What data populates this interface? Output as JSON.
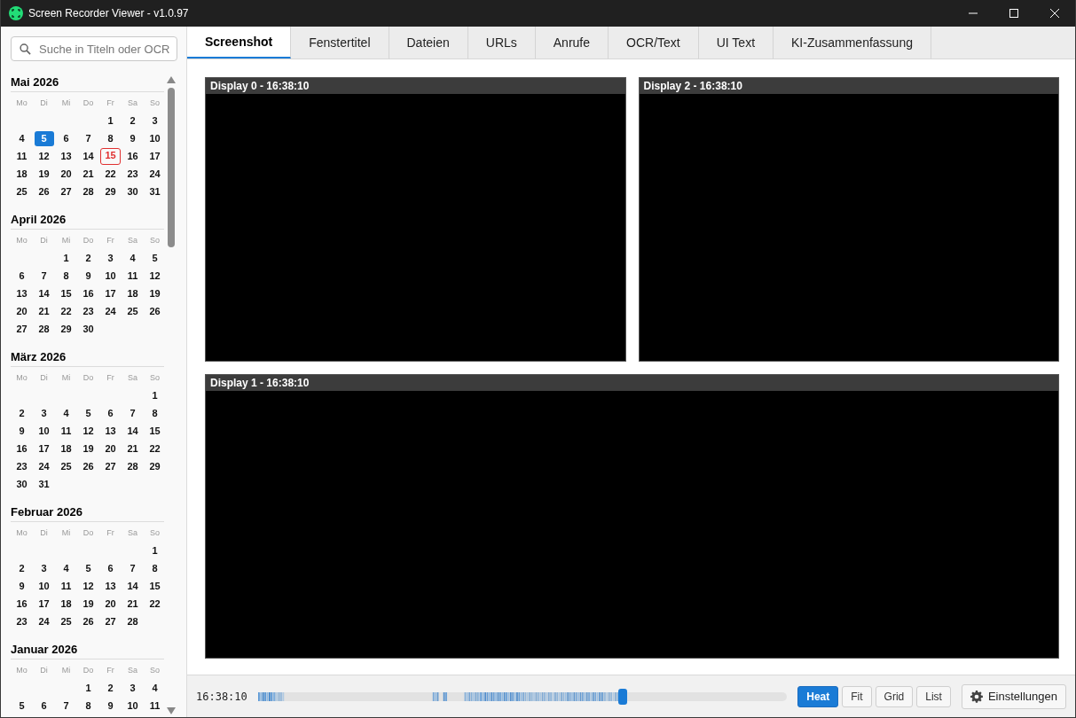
{
  "window": {
    "title": "Screen Recorder Viewer - v1.0.97"
  },
  "search": {
    "placeholder": "Suche in Titeln oder OCR"
  },
  "months": [
    {
      "title": "Mai 2026",
      "weekdays": [
        "Mo",
        "Di",
        "Mi",
        "Do",
        "Fr",
        "Sa",
        "So"
      ],
      "weeks": [
        {
          "kind": "leading",
          "days": [
            {
              "day": "1",
              "selected": false,
              "today": false
            },
            {
              "day": "2",
              "selected": false,
              "today": false
            },
            {
              "day": "3",
              "selected": false,
              "today": false
            }
          ]
        },
        {
          "days": [
            {
              "day": "4",
              "selected": false,
              "today": false
            },
            {
              "day": "5",
              "selected": true,
              "today": false
            },
            {
              "day": "6",
              "selected": false,
              "today": false
            },
            {
              "day": "7",
              "selected": false,
              "today": false
            },
            {
              "day": "8",
              "selected": false,
              "today": false
            },
            {
              "day": "9",
              "selected": false,
              "today": false
            },
            {
              "day": "10",
              "selected": false,
              "today": false
            }
          ]
        },
        {
          "days": [
            {
              "day": "11",
              "selected": false,
              "today": false
            },
            {
              "day": "12",
              "selected": false,
              "today": false
            },
            {
              "day": "13",
              "selected": false,
              "today": false
            },
            {
              "day": "14",
              "selected": false,
              "today": false
            },
            {
              "day": "15",
              "selected": false,
              "today": true
            },
            {
              "day": "16",
              "selected": false,
              "today": false
            },
            {
              "day": "17",
              "selected": false,
              "today": false
            }
          ]
        },
        {
          "days": [
            {
              "day": "18",
              "selected": false,
              "today": false
            },
            {
              "day": "19",
              "selected": false,
              "today": false
            },
            {
              "day": "20",
              "selected": false,
              "today": false
            },
            {
              "day": "21",
              "selected": false,
              "today": false
            },
            {
              "day": "22",
              "selected": false,
              "today": false
            },
            {
              "day": "23",
              "selected": false,
              "today": false
            },
            {
              "day": "24",
              "selected": false,
              "today": false
            }
          ]
        },
        {
          "days": [
            {
              "day": "25",
              "selected": false,
              "today": false
            },
            {
              "day": "26",
              "selected": false,
              "today": false
            },
            {
              "day": "27",
              "selected": false,
              "today": false
            },
            {
              "day": "28",
              "selected": false,
              "today": false
            },
            {
              "day": "29",
              "selected": false,
              "today": false
            },
            {
              "day": "30",
              "selected": false,
              "today": false
            },
            {
              "day": "31",
              "selected": false,
              "today": false
            }
          ]
        }
      ]
    },
    {
      "title": "April 2026",
      "weekdays": [
        "Mo",
        "Di",
        "Mi",
        "Do",
        "Fr",
        "Sa",
        "So"
      ],
      "weeks": [
        {
          "kind": "leading",
          "days": [
            {
              "day": "1",
              "selected": false,
              "today": false
            },
            {
              "day": "2",
              "selected": false,
              "today": false
            },
            {
              "day": "3",
              "selected": false,
              "today": false
            },
            {
              "day": "4",
              "selected": false,
              "today": false
            },
            {
              "day": "5",
              "selected": false,
              "today": false
            }
          ]
        },
        {
          "days": [
            {
              "day": "6",
              "selected": false,
              "today": false
            },
            {
              "day": "7",
              "selected": false,
              "today": false
            },
            {
              "day": "8",
              "selected": false,
              "today": false
            },
            {
              "day": "9",
              "selected": false,
              "today": false
            },
            {
              "day": "10",
              "selected": false,
              "today": false
            },
            {
              "day": "11",
              "selected": false,
              "today": false
            },
            {
              "day": "12",
              "selected": false,
              "today": false
            }
          ]
        },
        {
          "days": [
            {
              "day": "13",
              "selected": false,
              "today": false
            },
            {
              "day": "14",
              "selected": false,
              "today": false
            },
            {
              "day": "15",
              "selected": false,
              "today": false
            },
            {
              "day": "16",
              "selected": false,
              "today": false
            },
            {
              "day": "17",
              "selected": false,
              "today": false
            },
            {
              "day": "18",
              "selected": false,
              "today": false
            },
            {
              "day": "19",
              "selected": false,
              "today": false
            }
          ]
        },
        {
          "days": [
            {
              "day": "20",
              "selected": false,
              "today": false
            },
            {
              "day": "21",
              "selected": false,
              "today": false
            },
            {
              "day": "22",
              "selected": false,
              "today": false
            },
            {
              "day": "23",
              "selected": false,
              "today": false
            },
            {
              "day": "24",
              "selected": false,
              "today": false
            },
            {
              "day": "25",
              "selected": false,
              "today": false
            },
            {
              "day": "26",
              "selected": false,
              "today": false
            }
          ]
        },
        {
          "days": [
            {
              "day": "27",
              "selected": false,
              "today": false
            },
            {
              "day": "28",
              "selected": false,
              "today": false
            },
            {
              "day": "29",
              "selected": false,
              "today": false
            },
            {
              "day": "30",
              "selected": false,
              "today": false
            }
          ]
        }
      ]
    },
    {
      "title": "März 2026",
      "weekdays": [
        "Mo",
        "Di",
        "Mi",
        "Do",
        "Fr",
        "Sa",
        "So"
      ],
      "weeks": [
        {
          "kind": "leading",
          "days": [
            {
              "day": "1",
              "selected": false,
              "today": false
            }
          ]
        },
        {
          "days": [
            {
              "day": "2",
              "selected": false,
              "today": false
            },
            {
              "day": "3",
              "selected": false,
              "today": false
            },
            {
              "day": "4",
              "selected": false,
              "today": false
            },
            {
              "day": "5",
              "selected": false,
              "today": false
            },
            {
              "day": "6",
              "selected": false,
              "today": false
            },
            {
              "day": "7",
              "selected": false,
              "today": false
            },
            {
              "day": "8",
              "selected": false,
              "today": false
            }
          ]
        },
        {
          "days": [
            {
              "day": "9",
              "selected": false,
              "today": false
            },
            {
              "day": "10",
              "selected": false,
              "today": false
            },
            {
              "day": "11",
              "selected": false,
              "today": false
            },
            {
              "day": "12",
              "selected": false,
              "today": false
            },
            {
              "day": "13",
              "selected": false,
              "today": false
            },
            {
              "day": "14",
              "selected": false,
              "today": false
            },
            {
              "day": "15",
              "selected": false,
              "today": false
            }
          ]
        },
        {
          "days": [
            {
              "day": "16",
              "selected": false,
              "today": false
            },
            {
              "day": "17",
              "selected": false,
              "today": false
            },
            {
              "day": "18",
              "selected": false,
              "today": false
            },
            {
              "day": "19",
              "selected": false,
              "today": false
            },
            {
              "day": "20",
              "selected": false,
              "today": false
            },
            {
              "day": "21",
              "selected": false,
              "today": false
            },
            {
              "day": "22",
              "selected": false,
              "today": false
            }
          ]
        },
        {
          "days": [
            {
              "day": "23",
              "selected": false,
              "today": false
            },
            {
              "day": "24",
              "selected": false,
              "today": false
            },
            {
              "day": "25",
              "selected": false,
              "today": false
            },
            {
              "day": "26",
              "selected": false,
              "today": false
            },
            {
              "day": "27",
              "selected": false,
              "today": false
            },
            {
              "day": "28",
              "selected": false,
              "today": false
            },
            {
              "day": "29",
              "selected": false,
              "today": false
            }
          ]
        },
        {
          "days": [
            {
              "day": "30",
              "selected": false,
              "today": false
            },
            {
              "day": "31",
              "selected": false,
              "today": false
            }
          ]
        }
      ]
    },
    {
      "title": "Februar 2026",
      "weekdays": [
        "Mo",
        "Di",
        "Mi",
        "Do",
        "Fr",
        "Sa",
        "So"
      ],
      "weeks": [
        {
          "kind": "leading",
          "days": [
            {
              "day": "1",
              "selected": false,
              "today": false
            }
          ]
        },
        {
          "days": [
            {
              "day": "2",
              "selected": false,
              "today": false
            },
            {
              "day": "3",
              "selected": false,
              "today": false
            },
            {
              "day": "4",
              "selected": false,
              "today": false
            },
            {
              "day": "5",
              "selected": false,
              "today": false
            },
            {
              "day": "6",
              "selected": false,
              "today": false
            },
            {
              "day": "7",
              "selected": false,
              "today": false
            },
            {
              "day": "8",
              "selected": false,
              "today": false
            }
          ]
        },
        {
          "days": [
            {
              "day": "9",
              "selected": false,
              "today": false
            },
            {
              "day": "10",
              "selected": false,
              "today": false
            },
            {
              "day": "11",
              "selected": false,
              "today": false
            },
            {
              "day": "12",
              "selected": false,
              "today": false
            },
            {
              "day": "13",
              "selected": false,
              "today": false
            },
            {
              "day": "14",
              "selected": false,
              "today": false
            },
            {
              "day": "15",
              "selected": false,
              "today": false
            }
          ]
        },
        {
          "days": [
            {
              "day": "16",
              "selected": false,
              "today": false
            },
            {
              "day": "17",
              "selected": false,
              "today": false
            },
            {
              "day": "18",
              "selected": false,
              "today": false
            },
            {
              "day": "19",
              "selected": false,
              "today": false
            },
            {
              "day": "20",
              "selected": false,
              "today": false
            },
            {
              "day": "21",
              "selected": false,
              "today": false
            },
            {
              "day": "22",
              "selected": false,
              "today": false
            }
          ]
        },
        {
          "days": [
            {
              "day": "23",
              "selected": false,
              "today": false
            },
            {
              "day": "24",
              "selected": false,
              "today": false
            },
            {
              "day": "25",
              "selected": false,
              "today": false
            },
            {
              "day": "26",
              "selected": false,
              "today": false
            },
            {
              "day": "27",
              "selected": false,
              "today": false
            },
            {
              "day": "28",
              "selected": false,
              "today": false
            }
          ]
        }
      ]
    },
    {
      "title": "Januar 2026",
      "weekdays": [
        "Mo",
        "Di",
        "Mi",
        "Do",
        "Fr",
        "Sa",
        "So"
      ],
      "weeks": [
        {
          "kind": "leading",
          "days": [
            {
              "day": "1",
              "selected": false,
              "today": false
            },
            {
              "day": "2",
              "selected": false,
              "today": false
            },
            {
              "day": "3",
              "selected": false,
              "today": false
            },
            {
              "day": "4",
              "selected": false,
              "today": false
            }
          ]
        },
        {
          "days": [
            {
              "day": "5",
              "selected": false,
              "today": false
            },
            {
              "day": "6",
              "selected": false,
              "today": false
            },
            {
              "day": "7",
              "selected": false,
              "today": false
            },
            {
              "day": "8",
              "selected": false,
              "today": false
            },
            {
              "day": "9",
              "selected": false,
              "today": false
            },
            {
              "day": "10",
              "selected": false,
              "today": false
            },
            {
              "day": "11",
              "selected": false,
              "today": false
            }
          ]
        }
      ]
    }
  ],
  "tabs": [
    {
      "label": "Screenshot",
      "selected": true
    },
    {
      "label": "Fenstertitel",
      "selected": false
    },
    {
      "label": "Dateien",
      "selected": false
    },
    {
      "label": "URLs",
      "selected": false
    },
    {
      "label": "Anrufe",
      "selected": false
    },
    {
      "label": "OCR/Text",
      "selected": false
    },
    {
      "label": "UI Text",
      "selected": false
    },
    {
      "label": "KI-Zusammenfassung",
      "selected": false
    }
  ],
  "displays": [
    {
      "title": "Display 0 - 16:38:10"
    },
    {
      "title": "Display 2 - 16:38:10"
    },
    {
      "title": "Display 1 - 16:38:10"
    }
  ],
  "timeline": {
    "time": "16:38:10",
    "level": 0.69
  },
  "view_modes": [
    {
      "label": "Heat",
      "selected": true
    },
    {
      "label": "Fit",
      "selected": false
    },
    {
      "label": "Grid",
      "selected": false
    },
    {
      "label": "List",
      "selected": false
    }
  ],
  "settings_button": {
    "label": "Einstellungen"
  }
}
